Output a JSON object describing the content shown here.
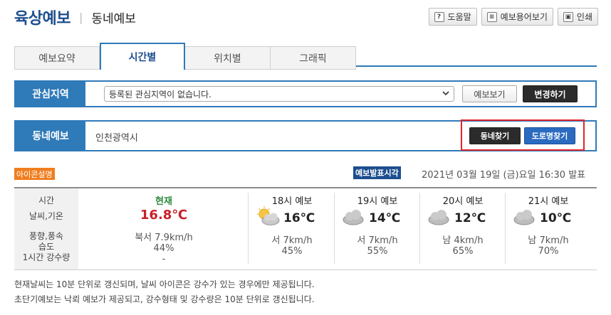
{
  "header": {
    "title": "육상예보",
    "separator": "|",
    "subtitle": "동네예보"
  },
  "tools": [
    {
      "icon": "question-icon",
      "glyph": "?",
      "label": "도움말"
    },
    {
      "icon": "book-icon",
      "glyph": "≡",
      "label": "예보용어보기"
    },
    {
      "icon": "print-icon",
      "glyph": "▣",
      "label": "인쇄"
    }
  ],
  "tabs": [
    {
      "label": "예보요약",
      "active": false
    },
    {
      "label": "시간별",
      "active": true
    },
    {
      "label": "위치별",
      "active": false
    },
    {
      "label": "그래픽",
      "active": false
    }
  ],
  "interest": {
    "label": "관심지역",
    "select_value": "등록된 관심지역이 없습니다.",
    "view_button": "예보보기",
    "change_button": "변경하기"
  },
  "dongne": {
    "label": "동네예보",
    "region": "인천광역시",
    "find_dong_button": "동네찾기",
    "find_road_button": "도로명찾기"
  },
  "info": {
    "icon_legend": "아이콘설명",
    "announce_label": "예보발표시각",
    "announce_time": "2021년 03월 19일 (금)요일 16:30 발표"
  },
  "row_labels": {
    "time": "시간",
    "weather_temp": "날씨,기온",
    "wind": "풍향,풍속",
    "humidity": "습도",
    "rain": "1시간 강수량"
  },
  "current": {
    "title": "현재",
    "temp": "16.8℃",
    "wind": "북서 7.9km/h",
    "humidity": "44%",
    "rain": "-"
  },
  "forecasts": [
    {
      "title": "18시 예보",
      "icon": "partly-cloudy-icon",
      "temp": "16℃",
      "wind": "서 7km/h",
      "humidity": "45%"
    },
    {
      "title": "19시 예보",
      "icon": "cloudy-icon",
      "temp": "14℃",
      "wind": "서 7km/h",
      "humidity": "55%"
    },
    {
      "title": "20시 예보",
      "icon": "cloudy-icon",
      "temp": "12℃",
      "wind": "남 4km/h",
      "humidity": "65%"
    },
    {
      "title": "21시 예보",
      "icon": "cloudy-icon",
      "temp": "10℃",
      "wind": "남 7km/h",
      "humidity": "70%"
    }
  ],
  "notes": [
    "현재날씨는 10분 단위로 갱신되며, 날씨 아이콘은 강수가 있는 경우에만 제공됩니다.",
    "초단기예보는 낙뢰 예보가 제공되고, 강수형태 및 강수량은 10분 단위로 갱신됩니다."
  ],
  "colors": {
    "brand_blue": "#2f7ab9",
    "title_blue": "#1d4e8f",
    "legend_orange": "#f07d1f",
    "current_green": "#2e8b3e",
    "current_red": "#c8202a",
    "highlight_red": "#e0262a"
  }
}
